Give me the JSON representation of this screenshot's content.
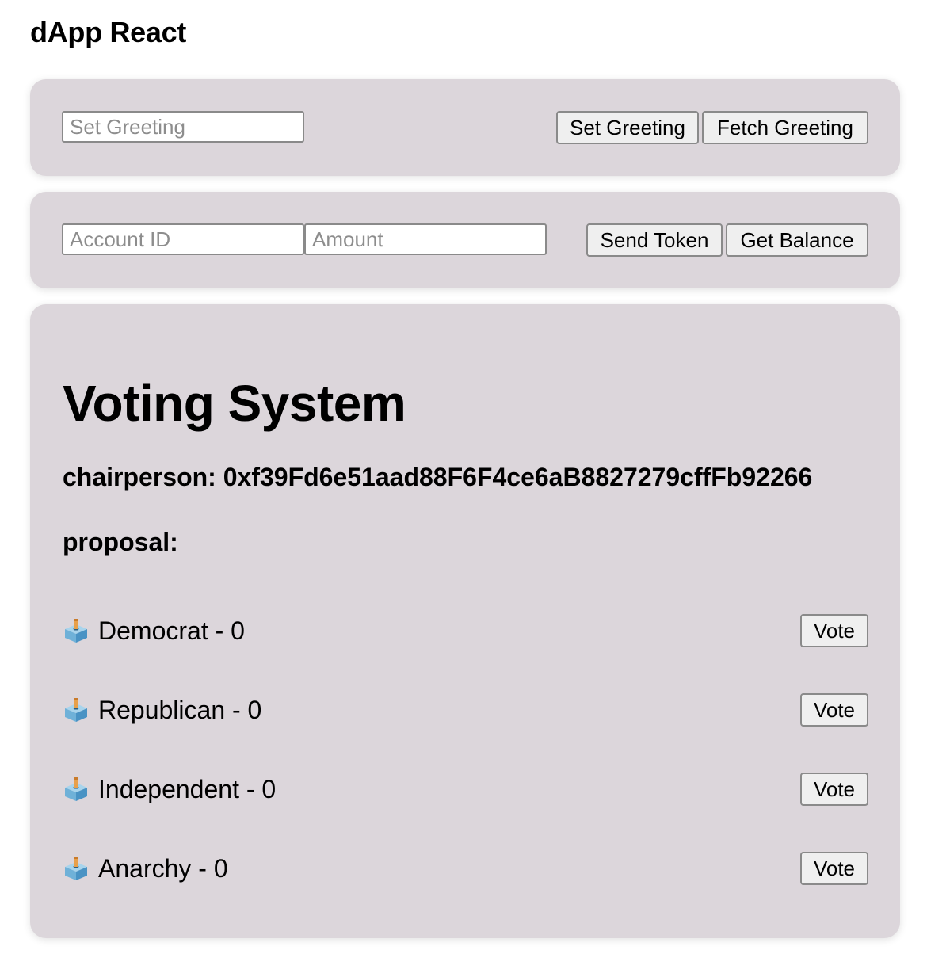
{
  "app": {
    "title": "dApp React"
  },
  "greeting": {
    "input_placeholder": "Set Greeting",
    "set_label": "Set Greeting",
    "fetch_label": "Fetch Greeting"
  },
  "token": {
    "account_placeholder": "Account ID",
    "amount_placeholder": "Amount",
    "send_label": "Send Token",
    "balance_label": "Get Balance"
  },
  "voting": {
    "title": "Voting System",
    "chairperson_label": "chairperson:",
    "chairperson_address": "0xf39Fd6e51aad88F6F4ce6aB8827279cffFb92266",
    "proposal_label": "proposal:",
    "proposals": [
      {
        "text": "Democrat - 0",
        "vote_label": "Vote",
        "icon": "ballot-box-icon"
      },
      {
        "text": "Republican - 0",
        "vote_label": "Vote",
        "icon": "ballot-box-icon"
      },
      {
        "text": "Independent - 0",
        "vote_label": "Vote",
        "icon": "ballot-box-icon"
      },
      {
        "text": "Anarchy - 0",
        "vote_label": "Vote",
        "icon": "ballot-box-icon"
      }
    ]
  }
}
